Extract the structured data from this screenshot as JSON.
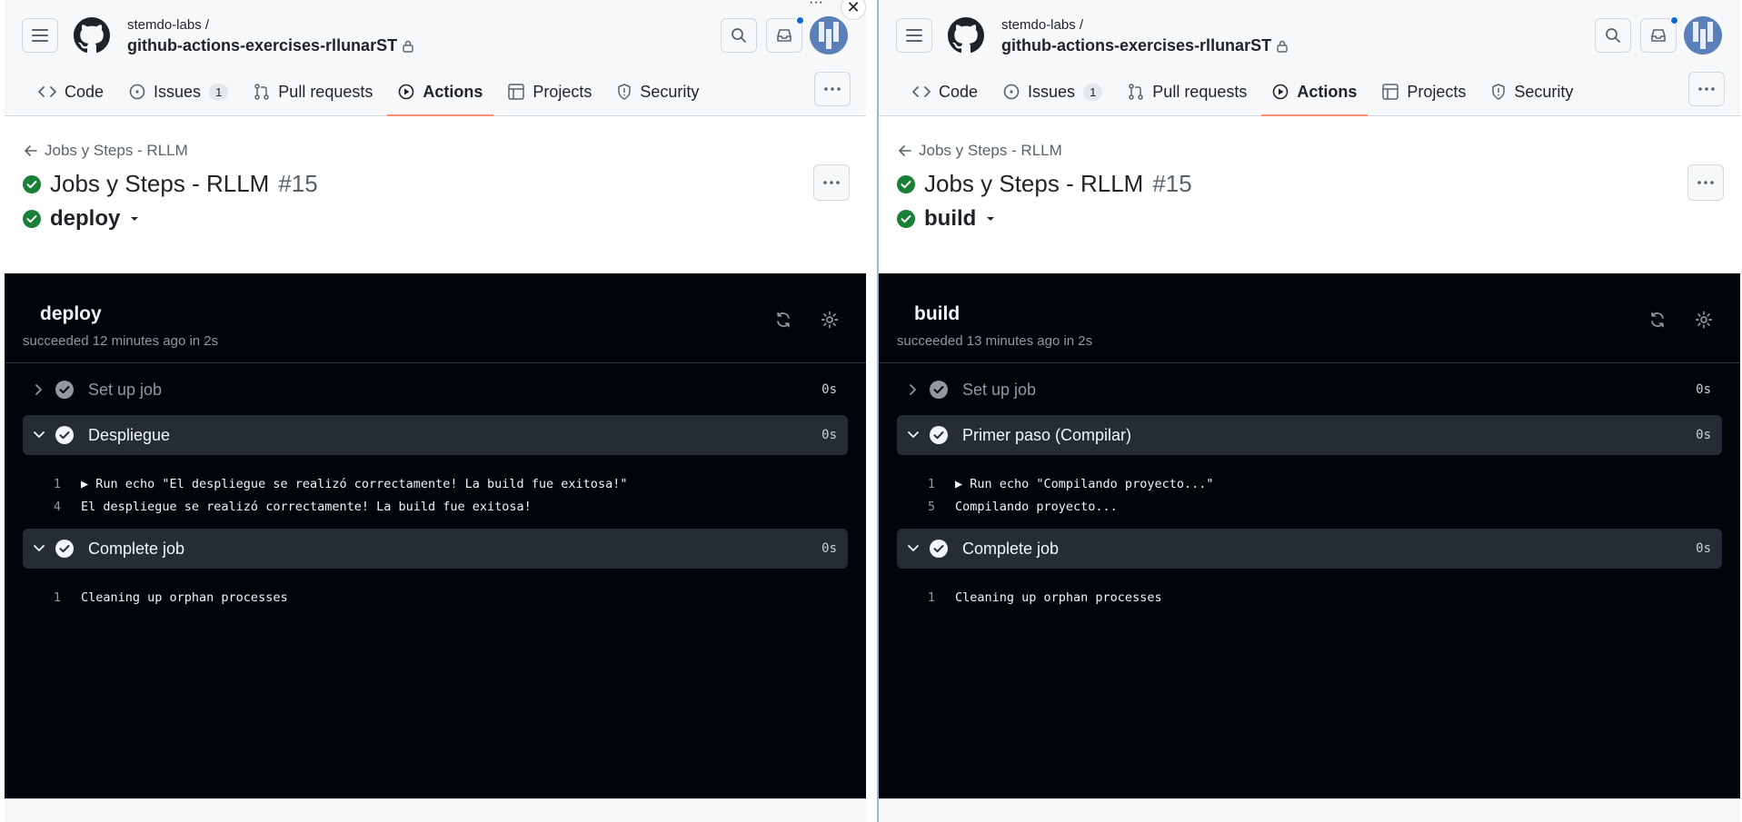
{
  "window_controls": {
    "more": "···",
    "close": "✕"
  },
  "panes": [
    {
      "owner": "stemdo-labs /",
      "repo": "github-actions-exercises-rllunarST",
      "tabs": [
        {
          "label": "Code",
          "icon": "code-icon"
        },
        {
          "label": "Issues",
          "icon": "issue-icon",
          "count": "1"
        },
        {
          "label": "Pull requests",
          "icon": "pull-request-icon"
        },
        {
          "label": "Actions",
          "icon": "play-icon",
          "active": true
        },
        {
          "label": "Projects",
          "icon": "table-icon"
        },
        {
          "label": "Security",
          "icon": "shield-icon"
        }
      ],
      "back_link": "Jobs y Steps - RLLM",
      "run_title": "Jobs y Steps - RLLM",
      "run_number": "#15",
      "job_selector": "deploy",
      "log": {
        "job_name": "deploy",
        "status": "succeeded 12 minutes ago in 2s",
        "steps": [
          {
            "label": "Set up job",
            "duration": "0s",
            "expanded": false,
            "lines": []
          },
          {
            "label": "Despliegue",
            "duration": "0s",
            "expanded": true,
            "lines": [
              {
                "n": "1",
                "text": "▶ Run echo \"El despliegue se realizó correctamente! La build fue exitosa!\""
              },
              {
                "n": "4",
                "text": "El despliegue se realizó correctamente! La build fue exitosa!"
              }
            ]
          },
          {
            "label": "Complete job",
            "duration": "0s",
            "expanded": true,
            "lines": [
              {
                "n": "1",
                "text": "Cleaning up orphan processes"
              }
            ]
          }
        ]
      }
    },
    {
      "owner": "stemdo-labs /",
      "repo": "github-actions-exercises-rllunarST",
      "tabs": [
        {
          "label": "Code",
          "icon": "code-icon"
        },
        {
          "label": "Issues",
          "icon": "issue-icon",
          "count": "1"
        },
        {
          "label": "Pull requests",
          "icon": "pull-request-icon"
        },
        {
          "label": "Actions",
          "icon": "play-icon",
          "active": true
        },
        {
          "label": "Projects",
          "icon": "table-icon"
        },
        {
          "label": "Security",
          "icon": "shield-icon"
        }
      ],
      "back_link": "Jobs y Steps - RLLM",
      "run_title": "Jobs y Steps - RLLM",
      "run_number": "#15",
      "job_selector": "build",
      "log": {
        "job_name": "build",
        "status": "succeeded 13 minutes ago in 2s",
        "steps": [
          {
            "label": "Set up job",
            "duration": "0s",
            "expanded": false,
            "lines": []
          },
          {
            "label": "Primer paso (Compilar)",
            "duration": "0s",
            "expanded": true,
            "lines": [
              {
                "n": "1",
                "text": "▶ Run echo \"Compilando proyecto...\""
              },
              {
                "n": "5",
                "text": "Compilando proyecto..."
              }
            ]
          },
          {
            "label": "Complete job",
            "duration": "0s",
            "expanded": true,
            "lines": [
              {
                "n": "1",
                "text": "Cleaning up orphan processes"
              }
            ]
          }
        ]
      }
    }
  ],
  "colors": {
    "success": "#1a7f37",
    "log_bg": "#010409",
    "step_open_bg": "#262c36",
    "active_tab": "#fd8c73",
    "notif": "#0969da"
  }
}
